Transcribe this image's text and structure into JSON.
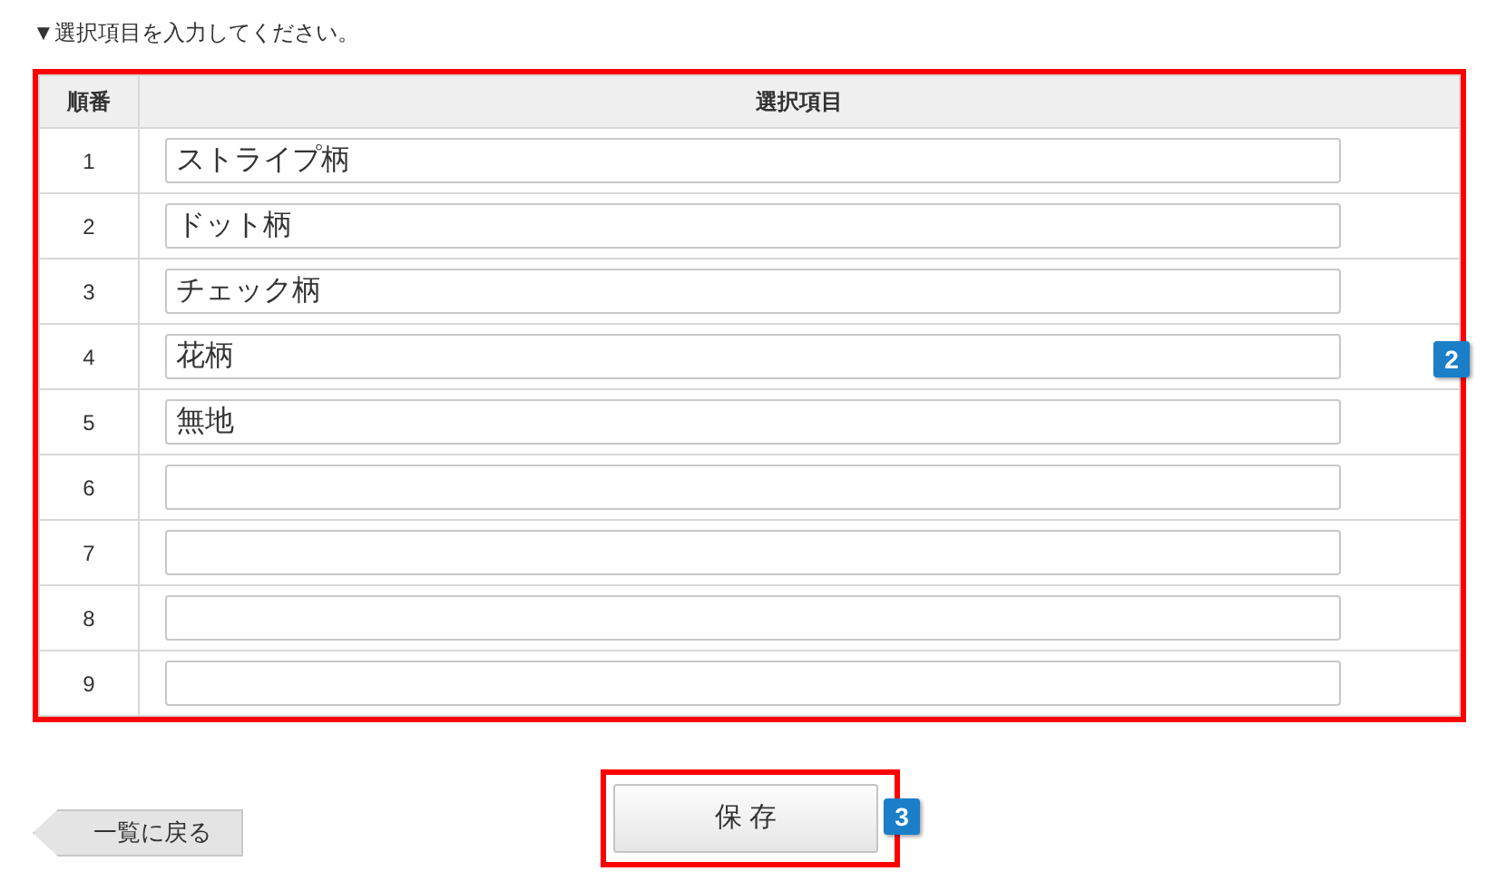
{
  "instruction": "▼選択項目を入力してください。",
  "table": {
    "columns": [
      "順番",
      "選択項目"
    ],
    "rows": [
      {
        "number": "1",
        "value": "ストライプ柄"
      },
      {
        "number": "2",
        "value": "ドット柄"
      },
      {
        "number": "3",
        "value": "チェック柄"
      },
      {
        "number": "4",
        "value": "花柄"
      },
      {
        "number": "5",
        "value": "無地"
      },
      {
        "number": "6"
      },
      {
        "number": "7"
      },
      {
        "number": "8"
      },
      {
        "number": "9"
      }
    ],
    "badge": "2"
  },
  "back_button": "一覧に戻る",
  "save_button": {
    "label": "保 存",
    "badge": "3"
  }
}
